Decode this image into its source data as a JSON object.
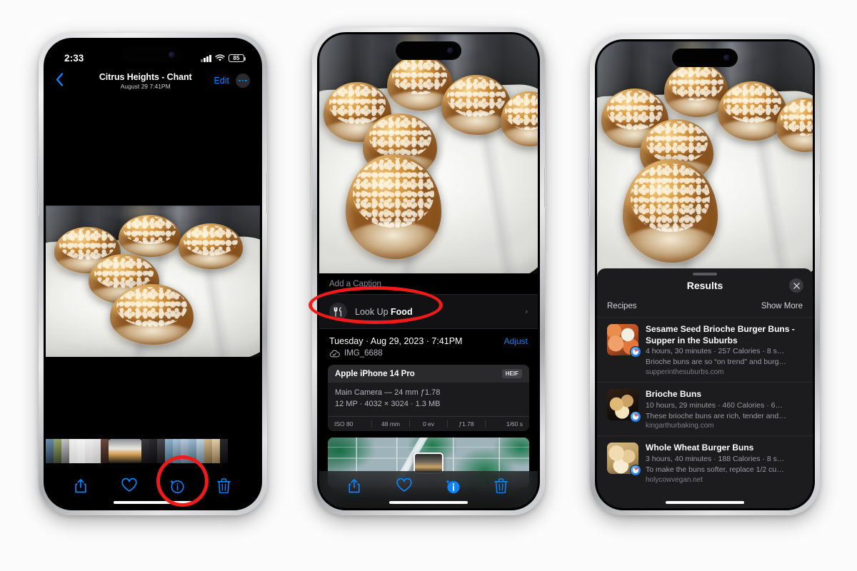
{
  "phone1": {
    "status": {
      "time": "2:33",
      "battery": "85",
      "wifi_icon": "wifi-icon",
      "cellular_icon": "cellular-bars-icon"
    },
    "nav": {
      "back_icon": "chevron-left-icon",
      "title": "Citrus Heights - Chant",
      "subtitle": "August 29  7:41PM",
      "edit_label": "Edit",
      "more_icon": "ellipsis-circle-icon"
    },
    "toolbar": {
      "share_icon": "share-icon",
      "favorite_icon": "heart-icon",
      "info_icon": "info-sparkle-icon",
      "delete_icon": "trash-icon"
    }
  },
  "phone2": {
    "caption_placeholder": "Add a Caption",
    "lookup": {
      "icon": "fork-knife-icon",
      "prefix": "Look Up ",
      "subject": "Food",
      "chevron": "chevron-right-icon"
    },
    "meta": {
      "date": "Tuesday · Aug 29, 2023 · 7:41PM",
      "adjust_label": "Adjust",
      "cloud_icon": "icloud-check-icon",
      "filename": "IMG_6688"
    },
    "exif": {
      "model": "Apple iPhone 14 Pro",
      "format": "HEIF",
      "lens": "Main Camera — 24 mm ƒ1.78",
      "specs": "12 MP · 4032 × 3024 · 1.3 MB",
      "strip": [
        "ISO 80",
        "48 mm",
        "0 ev",
        "ƒ1.78",
        "1/60 s"
      ]
    },
    "toolbar": {
      "share_icon": "share-icon",
      "favorite_icon": "heart-icon",
      "info_icon": "info-sparkle-filled-icon",
      "delete_icon": "trash-icon"
    }
  },
  "phone3": {
    "panel": {
      "grabber": "drag-handle",
      "title": "Results",
      "close_icon": "close-x-icon",
      "category": "Recipes",
      "show_more": "Show More"
    },
    "results": [
      {
        "title": "Sesame Seed Brioche Burger Buns - Supper in the Suburbs",
        "meta": "4 hours, 30 minutes · 257 Calories · 8 s…",
        "description": "Brioche buns are so “on trend\" and burg…",
        "domain": "supperinthesuburbs.com",
        "badge_icon": "safari-icon",
        "thumb_tone": "sesame"
      },
      {
        "title": "Brioche Buns",
        "meta": "10 hours, 29 minutes · 460 Calories · 6…",
        "description": "These brioche buns are rich, tender and…",
        "domain": "kingarthurbaking.com",
        "badge_icon": "safari-icon",
        "thumb_tone": "dark"
      },
      {
        "title": "Whole Wheat Burger Buns",
        "meta": "3 hours, 40 minutes · 188 Calories · 8 s…",
        "description": "To make the buns softer, replace 1/2 cu…",
        "domain": "holycowvegan.net",
        "badge_icon": "safari-icon",
        "thumb_tone": "light"
      }
    ]
  },
  "annotations": [
    {
      "name": "info-button-highlight",
      "shape": "ellipse"
    },
    {
      "name": "look-up-food-highlight",
      "shape": "ellipse"
    }
  ],
  "colors": {
    "accent_blue": "#0a84ff",
    "annotation_red": "#ef1b1b",
    "page_background": "#fbfbfb",
    "sheet_background": "#1c1c1e"
  }
}
